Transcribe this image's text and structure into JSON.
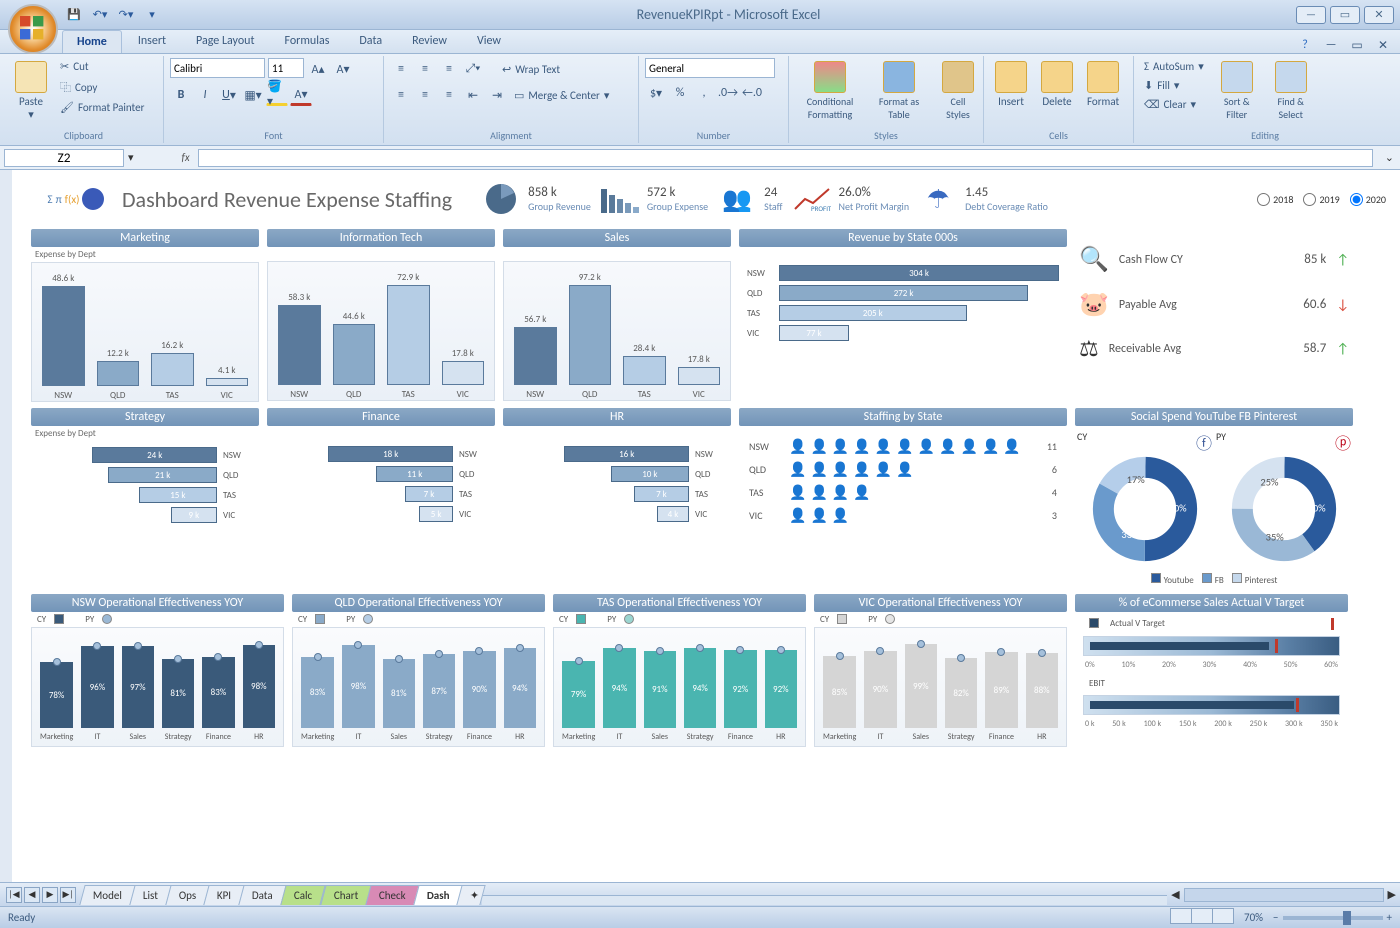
{
  "window": {
    "title": "RevenueKPIRpt - Microsoft Excel"
  },
  "tabs": {
    "home": "Home",
    "insert": "Insert",
    "page_layout": "Page Layout",
    "formulas": "Formulas",
    "data": "Data",
    "review": "Review",
    "view": "View"
  },
  "ribbon": {
    "clipboard": {
      "label": "Clipboard",
      "paste": "Paste",
      "cut": "Cut",
      "copy": "Copy",
      "format_painter": "Format Painter"
    },
    "font": {
      "label": "Font",
      "name": "Calibri",
      "size": "11"
    },
    "alignment": {
      "label": "Alignment",
      "wrap": "Wrap Text",
      "merge": "Merge & Center"
    },
    "number": {
      "label": "Number",
      "format": "General"
    },
    "styles": {
      "label": "Styles",
      "cond": "Conditional Formatting",
      "table": "Format as Table",
      "cell": "Cell Styles"
    },
    "cells": {
      "label": "Cells",
      "insert": "Insert",
      "delete": "Delete",
      "format": "Format"
    },
    "editing": {
      "label": "Editing",
      "autosum": "AutoSum",
      "fill": "Fill",
      "clear": "Clear",
      "sort": "Sort & Filter",
      "find": "Find & Select"
    }
  },
  "name_box": "Z2",
  "status": {
    "ready": "Ready",
    "zoom": "70%"
  },
  "sheets": [
    "Model",
    "List",
    "Ops",
    "KPI",
    "Data",
    "Calc",
    "Chart",
    "Check",
    "Dash"
  ],
  "dashboard": {
    "title": "Dashboard Revenue Expense Staffing",
    "kpis": {
      "revenue": {
        "value": "858 k",
        "label": "Group Revenue"
      },
      "expense": {
        "value": "572 k",
        "label": "Group Expense"
      },
      "staff": {
        "value": "24",
        "label": "Staff"
      },
      "margin": {
        "value": "26.0%",
        "label": "Net Profit Margin"
      },
      "debt": {
        "value": "1.45",
        "label": "Debt Coverage Ratio"
      }
    },
    "years": {
      "y18": "2018",
      "y19": "2019",
      "y20": "2020"
    },
    "exp_label": "Expense by Dept",
    "headers": {
      "marketing": "Marketing",
      "it": "Information Tech",
      "sales": "Sales",
      "rev_state": "Revenue by State 000s",
      "strategy": "Strategy",
      "finance": "Finance",
      "hr": "HR",
      "staff_state": "Staffing by State",
      "social": "Social Spend YouTube FB Pinterest",
      "nsw_eff": "NSW Operational Effectiveness YOY",
      "qld_eff": "QLD Operational Effectiveness YOY",
      "tas_eff": "TAS Operational Effectiveness YOY",
      "vic_eff": "VIC Operational Effectiveness YOY",
      "ecom": "% of eCommerse Sales Actual V Target"
    },
    "cards": {
      "cashflow": {
        "name": "Cash Flow CY",
        "value": "85 k"
      },
      "payable": {
        "name": "Payable Avg",
        "value": "60.6"
      },
      "receivable": {
        "name": "Receivable Avg",
        "value": "58.7"
      }
    },
    "legends": {
      "cy": "CY",
      "py": "PY",
      "youtube": "Youtube",
      "fb": "FB",
      "pinterest": "Pinterest",
      "avt": "Actual V Target",
      "ebit": "EBIT"
    },
    "donut_cy": {
      "yt": "50%",
      "fb": "33%",
      "pin": "17%"
    },
    "donut_py": {
      "yt": "40%",
      "fb": "35%",
      "pin": "25%"
    }
  },
  "chart_data": [
    {
      "type": "bar",
      "title": "Marketing Expense by Dept",
      "categories": [
        "NSW",
        "QLD",
        "TAS",
        "VIC"
      ],
      "values": [
        48.6,
        12.2,
        16.2,
        4.1
      ],
      "unit": "k"
    },
    {
      "type": "bar",
      "title": "Information Tech Expense by Dept",
      "categories": [
        "NSW",
        "QLD",
        "TAS",
        "VIC"
      ],
      "values": [
        58.3,
        44.6,
        72.9,
        17.8
      ],
      "unit": "k"
    },
    {
      "type": "bar",
      "title": "Sales Expense by Dept",
      "categories": [
        "NSW",
        "QLD",
        "TAS",
        "VIC"
      ],
      "values": [
        56.7,
        97.2,
        28.4,
        17.8
      ],
      "unit": "k"
    },
    {
      "type": "bar",
      "orientation": "horizontal",
      "title": "Revenue by State 000s",
      "categories": [
        "NSW",
        "QLD",
        "TAS",
        "VIC"
      ],
      "values": [
        304,
        272,
        205,
        77
      ],
      "unit": "k"
    },
    {
      "type": "bar",
      "orientation": "horizontal",
      "title": "Strategy Expense by Dept",
      "categories": [
        "NSW",
        "QLD",
        "TAS",
        "VIC"
      ],
      "values": [
        24,
        21,
        15,
        9
      ],
      "unit": "k"
    },
    {
      "type": "bar",
      "orientation": "horizontal",
      "title": "Finance Expense by Dept",
      "categories": [
        "NSW",
        "QLD",
        "TAS",
        "VIC"
      ],
      "values": [
        18,
        11,
        7,
        5
      ],
      "unit": "k"
    },
    {
      "type": "bar",
      "orientation": "horizontal",
      "title": "HR Expense by Dept",
      "categories": [
        "NSW",
        "QLD",
        "TAS",
        "VIC"
      ],
      "values": [
        16,
        10,
        7,
        4
      ],
      "unit": "k"
    },
    {
      "type": "table",
      "title": "Staffing by State",
      "categories": [
        "NSW",
        "QLD",
        "TAS",
        "VIC"
      ],
      "values": [
        11,
        6,
        4,
        3
      ]
    },
    {
      "type": "pie",
      "title": "Social Spend CY",
      "series": [
        {
          "name": "Youtube",
          "value": 50
        },
        {
          "name": "FB",
          "value": 33
        },
        {
          "name": "Pinterest",
          "value": 17
        }
      ]
    },
    {
      "type": "pie",
      "title": "Social Spend PY",
      "series": [
        {
          "name": "Youtube",
          "value": 40
        },
        {
          "name": "FB",
          "value": 35
        },
        {
          "name": "Pinterest",
          "value": 25
        }
      ]
    },
    {
      "type": "bar",
      "title": "NSW Operational Effectiveness YOY",
      "categories": [
        "Marketing",
        "IT",
        "Sales",
        "Strategy",
        "Finance",
        "HR"
      ],
      "series": [
        {
          "name": "CY",
          "values": [
            78,
            96,
            97,
            81,
            83,
            98
          ]
        },
        {
          "name": "PY",
          "values": [
            82,
            95,
            96,
            84,
            85,
            97
          ]
        }
      ],
      "unit": "%"
    },
    {
      "type": "bar",
      "title": "QLD Operational Effectiveness YOY",
      "categories": [
        "Marketing",
        "IT",
        "Sales",
        "Strategy",
        "Finance",
        "HR"
      ],
      "series": [
        {
          "name": "CY",
          "values": [
            83,
            98,
            81,
            87,
            90,
            94
          ]
        }
      ],
      "unit": "%"
    },
    {
      "type": "bar",
      "title": "TAS Operational Effectiveness YOY",
      "categories": [
        "Marketing",
        "IT",
        "Sales",
        "Strategy",
        "Finance",
        "HR"
      ],
      "series": [
        {
          "name": "CY",
          "values": [
            79,
            94,
            91,
            94,
            92,
            92
          ]
        }
      ],
      "unit": "%"
    },
    {
      "type": "bar",
      "title": "VIC Operational Effectiveness YOY",
      "categories": [
        "Marketing",
        "IT",
        "Sales",
        "Strategy",
        "Finance",
        "HR"
      ],
      "series": [
        {
          "name": "CY",
          "values": [
            85,
            90,
            99,
            82,
            89,
            88
          ]
        }
      ],
      "unit": "%"
    },
    {
      "type": "bar",
      "title": "Actual V Target",
      "xlim": [
        0,
        60
      ],
      "actual": 42,
      "target": 45,
      "unit": "%"
    },
    {
      "type": "bar",
      "title": "EBIT",
      "xlim": [
        0,
        350
      ],
      "actual": 280,
      "target": 290,
      "unit": "k"
    }
  ]
}
